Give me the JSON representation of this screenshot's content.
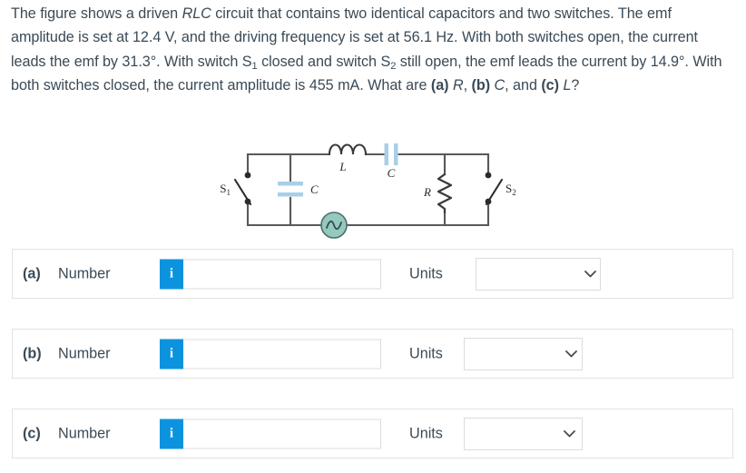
{
  "question": {
    "segments": [
      {
        "t": "The figure shows a driven ",
        "s": "n"
      },
      {
        "t": "RLC",
        "s": "i"
      },
      {
        "t": " circuit that contains two identical capacitors and two switches. The emf amplitude is set at 12.4 V, and the driving frequency is set at 56.1 Hz. With both switches open, the current leads the emf by 31.3°. With switch S",
        "s": "n"
      },
      {
        "t": "1",
        "s": "sub"
      },
      {
        "t": " closed and switch S",
        "s": "n"
      },
      {
        "t": "2",
        "s": "sub"
      },
      {
        "t": " still open, the emf leads the current by 14.9°. With both switches closed, the current amplitude is 455 mA. What are ",
        "s": "n"
      },
      {
        "t": "(a)",
        "s": "b"
      },
      {
        "t": " ",
        "s": "n"
      },
      {
        "t": "R",
        "s": "i"
      },
      {
        "t": ", ",
        "s": "n"
      },
      {
        "t": "(b)",
        "s": "b"
      },
      {
        "t": " ",
        "s": "n"
      },
      {
        "t": "C",
        "s": "i"
      },
      {
        "t": ", and ",
        "s": "n"
      },
      {
        "t": "(c)",
        "s": "b"
      },
      {
        "t": " ",
        "s": "n"
      },
      {
        "t": "L",
        "s": "i"
      },
      {
        "t": "?",
        "s": "n"
      }
    ],
    "emf_amplitude": "12.4 V",
    "driving_frequency": "56.1 Hz",
    "phase_both_open": "31.3°",
    "phase_s1_closed": "14.9°",
    "current_amplitude": "455 mA"
  },
  "figure": {
    "labels": {
      "switch1": "S",
      "switch1_sub": "1",
      "switch2": "S",
      "switch2_sub": "2",
      "inductor": "L",
      "capacitor_top": "C",
      "capacitor_left": "C",
      "resistor": "R"
    },
    "colors": {
      "wire": "#595959",
      "capacitor_plate": "#a8cfe8",
      "source_fill": "#95c8bf",
      "source_stroke": "#4b6f69"
    }
  },
  "rows": [
    {
      "id": "a",
      "part_label": "(a)",
      "number_label": "Number",
      "info_glyph": "i",
      "number_value": "",
      "number_placeholder": "",
      "units_label": "Units",
      "units_value": "",
      "units_options": [
        ""
      ]
    },
    {
      "id": "b",
      "part_label": "(b)",
      "number_label": "Number",
      "info_glyph": "i",
      "number_value": "",
      "number_placeholder": "",
      "units_label": "Units",
      "units_value": "",
      "units_options": [
        ""
      ]
    },
    {
      "id": "c",
      "part_label": "(c)",
      "number_label": "Number",
      "info_glyph": "i",
      "number_value": "",
      "number_placeholder": "",
      "units_label": "Units",
      "units_value": "",
      "units_options": [
        ""
      ]
    }
  ]
}
